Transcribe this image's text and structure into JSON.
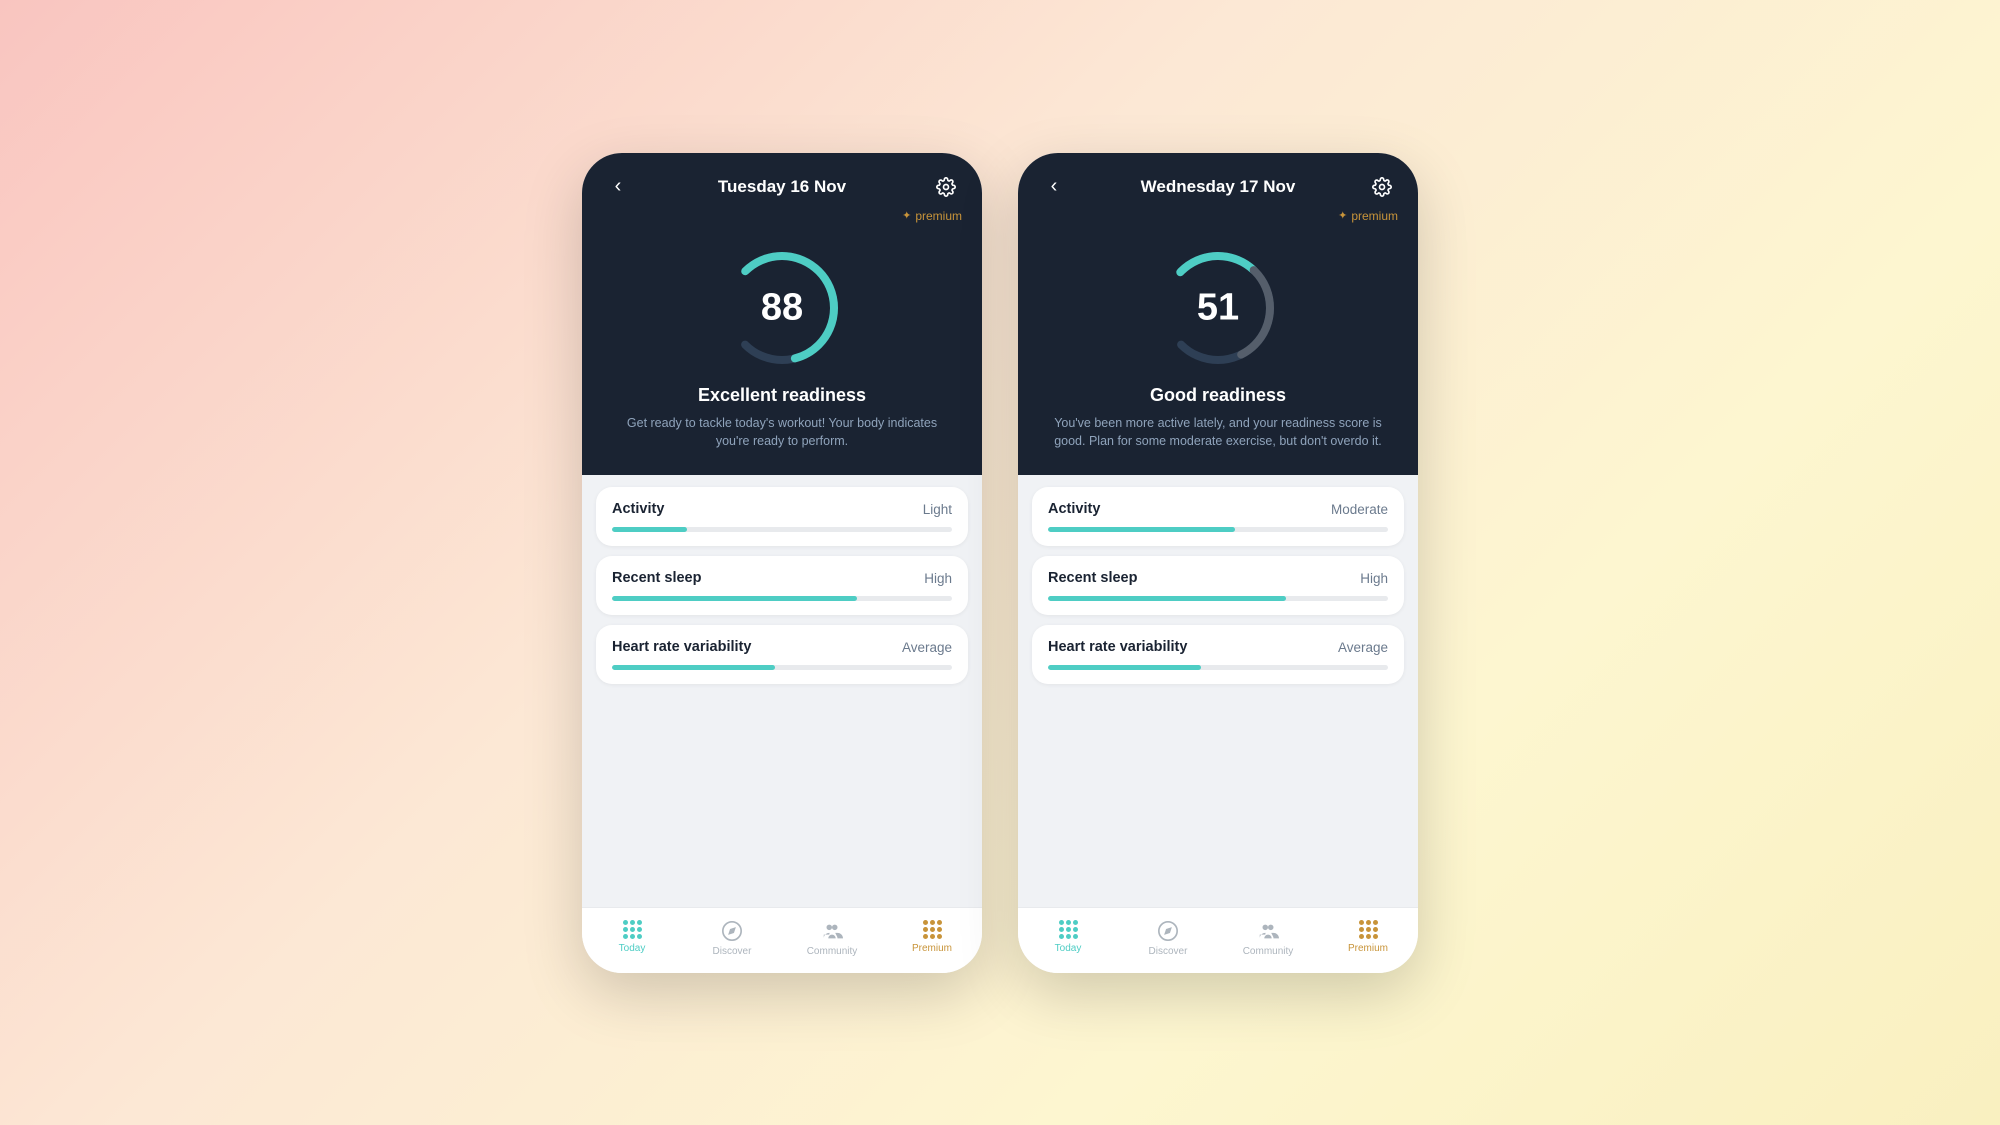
{
  "phone1": {
    "header": {
      "date": "Tuesday 16 Nov",
      "premium_label": "premium"
    },
    "score": {
      "value": "88",
      "readiness_title": "Excellent readiness",
      "readiness_desc": "Get ready to tackle today's workout! Your body indicates you're ready to perform.",
      "ring_percent": 0.78,
      "ring_color": "teal"
    },
    "metrics": [
      {
        "name": "Activity",
        "level": "Light",
        "bar_width": "22%"
      },
      {
        "name": "Recent sleep",
        "level": "High",
        "bar_width": "72%"
      },
      {
        "name": "Heart rate variability",
        "level": "Average",
        "bar_width": "48%"
      }
    ],
    "nav": [
      {
        "label": "Today",
        "active": true,
        "type": "today"
      },
      {
        "label": "Discover",
        "active": false,
        "type": "discover"
      },
      {
        "label": "Community",
        "active": false,
        "type": "community"
      },
      {
        "label": "Premium",
        "active": false,
        "type": "premium"
      }
    ]
  },
  "phone2": {
    "header": {
      "date": "Wednesday 17 Nov",
      "premium_label": "premium"
    },
    "score": {
      "value": "51",
      "readiness_title": "Good readiness",
      "readiness_desc": "You've been more active lately, and your readiness score is good. Plan for some moderate exercise, but don't overdo it.",
      "ring_percent": 0.45,
      "ring_color": "gray"
    },
    "metrics": [
      {
        "name": "Activity",
        "level": "Moderate",
        "bar_width": "55%"
      },
      {
        "name": "Recent sleep",
        "level": "High",
        "bar_width": "70%"
      },
      {
        "name": "Heart rate variability",
        "level": "Average",
        "bar_width": "45%"
      }
    ],
    "nav": [
      {
        "label": "Today",
        "active": true,
        "type": "today"
      },
      {
        "label": "Discover",
        "active": false,
        "type": "discover"
      },
      {
        "label": "Community",
        "active": false,
        "type": "community"
      },
      {
        "label": "Premium",
        "active": false,
        "type": "premium"
      }
    ]
  }
}
